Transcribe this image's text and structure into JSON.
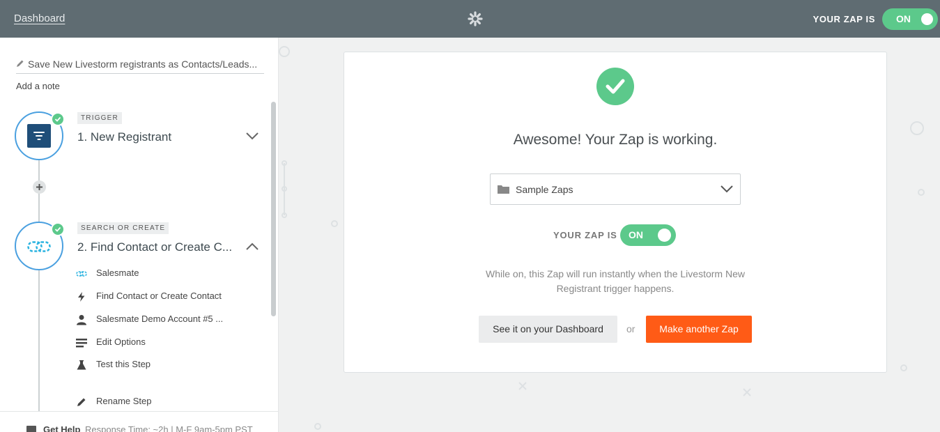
{
  "topbar": {
    "dashboard_link": "Dashboard",
    "zap_is_label": "YOUR ZAP IS",
    "toggle_state": "ON"
  },
  "sidebar": {
    "zap_name": "Save New Livestorm registrants as Contacts/Leads...",
    "add_note": "Add a note",
    "steps": [
      {
        "tag": "TRIGGER",
        "title": "1. New Registrant",
        "icon": "funnel-icon",
        "expanded": false
      },
      {
        "tag": "SEARCH OR CREATE",
        "title": "2. Find Contact or Create C...",
        "icon": "salesmate-icon",
        "expanded": true,
        "items": [
          {
            "icon": "salesmate-icon",
            "label": "Salesmate"
          },
          {
            "icon": "lightning-icon",
            "label": "Find Contact or Create Contact"
          },
          {
            "icon": "user-icon",
            "label": "Salesmate Demo Account #5 ..."
          },
          {
            "icon": "list-icon",
            "label": "Edit Options"
          },
          {
            "icon": "flask-icon",
            "label": "Test this Step"
          },
          {
            "icon": "pencil-icon",
            "label": "Rename Step"
          }
        ]
      }
    ],
    "help": {
      "title": "Get Help",
      "subtitle": "Response Time: ~2h | M-F 9am-5pm PST"
    }
  },
  "card": {
    "headline": "Awesome! Your Zap is working.",
    "folder": "Sample Zaps",
    "zap_is_label": "YOUR ZAP IS",
    "toggle_state": "ON",
    "description": "While on, this Zap will run instantly when the Livestorm New Registrant trigger happens.",
    "dashboard_button": "See it on your Dashboard",
    "or_text": "or",
    "make_button": "Make another Zap"
  },
  "colors": {
    "topbar": "#5f6c72",
    "success": "#5cc98b",
    "accent_orange": "#ff5b16",
    "step_border": "#4aa0e0"
  }
}
